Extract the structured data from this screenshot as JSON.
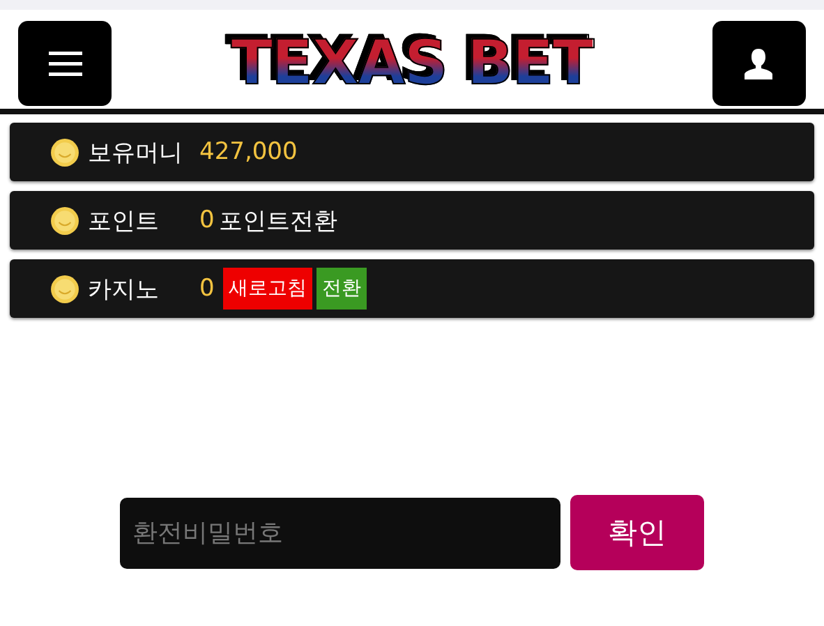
{
  "header": {
    "logo": "TEXAS BET"
  },
  "rows": [
    {
      "kind": "plain",
      "label": "보유머니",
      "value": "427,000"
    },
    {
      "kind": "link",
      "label": "포인트",
      "value": "0",
      "link": "포인트전환"
    },
    {
      "kind": "buttons",
      "label": "카지노",
      "value": "0",
      "buttons": [
        {
          "label": "새로고침",
          "color": "#ee0000"
        },
        {
          "label": "전환",
          "color": "#3a9a22"
        }
      ]
    }
  ],
  "form": {
    "placeholder": "환전비밀번호",
    "button": "확인"
  }
}
